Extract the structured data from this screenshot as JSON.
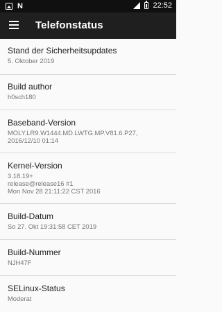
{
  "status_bar": {
    "time": "22:52",
    "notification_letter": "N"
  },
  "app_bar": {
    "title": "Telefonstatus",
    "menu_icon": "hamburger-menu-icon"
  },
  "items": [
    {
      "label": "Stand der Sicherheitsupdates",
      "value": "5. Oktober 2019"
    },
    {
      "label": "Build author",
      "value": "h0sch180"
    },
    {
      "label": "Baseband-Version",
      "value": "MOLY.LR9.W1444.MD.LWTG.MP.V81.6.P27,\n2016/12/10 01:14"
    },
    {
      "label": "Kernel-Version",
      "value": "3.18.19+\nrelease@release16 #1\nMon Nov 28 21:11:22 CST 2016"
    },
    {
      "label": "Build-Datum",
      "value": "So 27. Okt 19:31:58 CET 2019"
    },
    {
      "label": "Build-Nummer",
      "value": "NJH47F"
    },
    {
      "label": "SELinux-Status",
      "value": "Moderat"
    }
  ]
}
